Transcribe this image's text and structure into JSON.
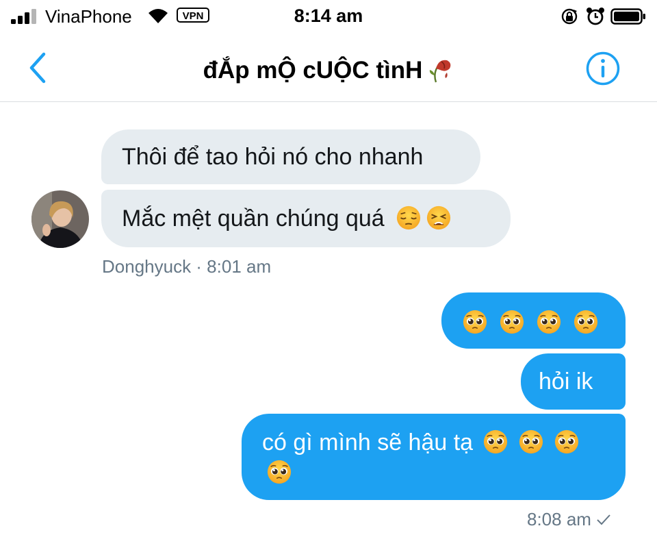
{
  "status_bar": {
    "carrier": "VinaPhone",
    "vpn_label": "VPN",
    "time": "8:14 am",
    "icons": [
      "signal-icon",
      "wifi-icon",
      "orientation-lock-icon",
      "alarm-icon",
      "battery-icon"
    ]
  },
  "header": {
    "title": "đẮp mỘ cUỘC tìnH",
    "title_icon": "wilted-rose-icon",
    "back_icon": "back-chevron-icon",
    "info_icon": "info-icon"
  },
  "messages": {
    "incoming": [
      {
        "text": "Thôi để tao hỏi nó cho nhanh",
        "emojis": []
      },
      {
        "text": "Mắc mệt quần chúng quá",
        "emojis": [
          "pensive-face-icon",
          "weary-face-icon"
        ]
      }
    ],
    "incoming_meta": "Donghyuck · 8:01 am",
    "outgoing": [
      {
        "text": "",
        "emojis": [
          "pleading-face-icon",
          "pleading-face-icon",
          "pleading-face-icon",
          "pleading-face-icon"
        ]
      },
      {
        "text": "hỏi ik",
        "emojis": []
      },
      {
        "text": "có gì mình sẽ hậu tạ",
        "emojis": [
          "pleading-face-icon",
          "pleading-face-icon",
          "pleading-face-icon",
          "pleading-face-icon"
        ]
      }
    ],
    "outgoing_meta": "8:08 am"
  },
  "colors": {
    "accent": "#1da1f2",
    "incoming_bubble": "#e6ecf0",
    "meta_text": "#657786"
  }
}
